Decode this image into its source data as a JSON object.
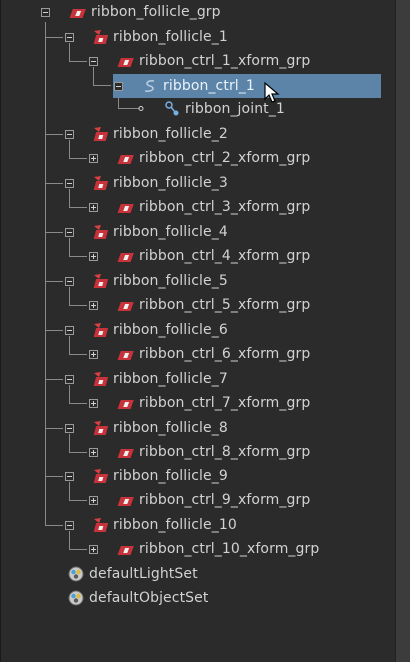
{
  "outliner": {
    "nodes": [
      {
        "label": "ribbon_follicle_grp",
        "icon": "transform-group-icon"
      },
      {
        "label": "ribbon_follicle_1",
        "icon": "follicle-icon"
      },
      {
        "label": "ribbon_ctrl_1_xform_grp",
        "icon": "transform-group-icon"
      },
      {
        "label": "ribbon_ctrl_1",
        "icon": "nurbs-curve-icon"
      },
      {
        "label": "ribbon_joint_1",
        "icon": "joint-icon"
      },
      {
        "label": "ribbon_follicle_2",
        "icon": "follicle-icon"
      },
      {
        "label": "ribbon_ctrl_2_xform_grp",
        "icon": "transform-group-icon"
      },
      {
        "label": "ribbon_follicle_3",
        "icon": "follicle-icon"
      },
      {
        "label": "ribbon_ctrl_3_xform_grp",
        "icon": "transform-group-icon"
      },
      {
        "label": "ribbon_follicle_4",
        "icon": "follicle-icon"
      },
      {
        "label": "ribbon_ctrl_4_xform_grp",
        "icon": "transform-group-icon"
      },
      {
        "label": "ribbon_follicle_5",
        "icon": "follicle-icon"
      },
      {
        "label": "ribbon_ctrl_5_xform_grp",
        "icon": "transform-group-icon"
      },
      {
        "label": "ribbon_follicle_6",
        "icon": "follicle-icon"
      },
      {
        "label": "ribbon_ctrl_6_xform_grp",
        "icon": "transform-group-icon"
      },
      {
        "label": "ribbon_follicle_7",
        "icon": "follicle-icon"
      },
      {
        "label": "ribbon_ctrl_7_xform_grp",
        "icon": "transform-group-icon"
      },
      {
        "label": "ribbon_follicle_8",
        "icon": "follicle-icon"
      },
      {
        "label": "ribbon_ctrl_8_xform_grp",
        "icon": "transform-group-icon"
      },
      {
        "label": "ribbon_follicle_9",
        "icon": "follicle-icon"
      },
      {
        "label": "ribbon_ctrl_9_xform_grp",
        "icon": "transform-group-icon"
      },
      {
        "label": "ribbon_follicle_10",
        "icon": "follicle-icon"
      },
      {
        "label": "ribbon_ctrl_10_xform_grp",
        "icon": "transform-group-icon"
      },
      {
        "label": "defaultLightSet",
        "icon": "object-set-icon"
      },
      {
        "label": "defaultObjectSet",
        "icon": "object-set-icon"
      }
    ],
    "selected_label": "ribbon_ctrl_1"
  },
  "colors": {
    "background": "#2b2b2b",
    "selection": "#5b84a8",
    "text": "#d2d2d2",
    "group_icon_red": "#c8323a",
    "joint_icon_blue": "#78aee0"
  }
}
